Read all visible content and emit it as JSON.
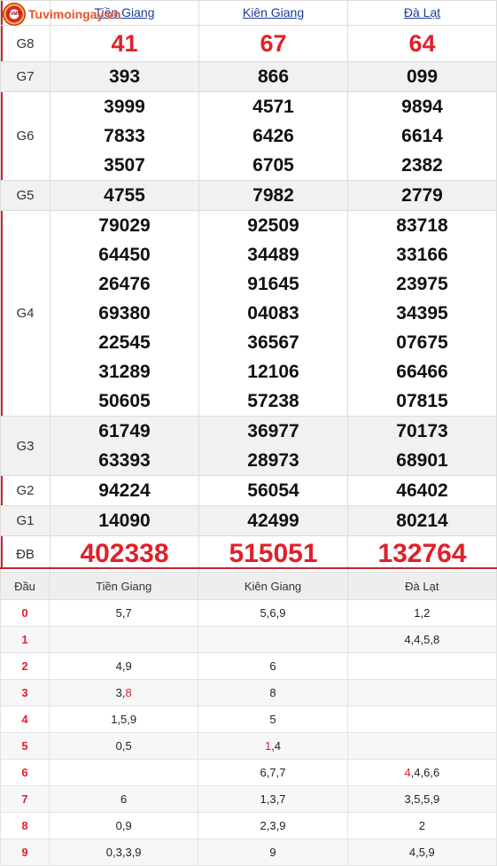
{
  "site": {
    "logo_text": "Tuvimoingay.vn",
    "logo_badge": "TVMN"
  },
  "provinces": [
    "Tiền Giang",
    "Kiên Giang",
    "Đà Lạt"
  ],
  "prizes": [
    {
      "label": "G8",
      "values": [
        [
          "41"
        ],
        [
          "67"
        ],
        [
          "64"
        ]
      ]
    },
    {
      "label": "G7",
      "values": [
        [
          "393"
        ],
        [
          "866"
        ],
        [
          "099"
        ]
      ]
    },
    {
      "label": "G6",
      "values": [
        [
          "3999",
          "7833",
          "3507"
        ],
        [
          "4571",
          "6426",
          "6705"
        ],
        [
          "9894",
          "6614",
          "2382"
        ]
      ]
    },
    {
      "label": "G5",
      "values": [
        [
          "4755"
        ],
        [
          "7982"
        ],
        [
          "2779"
        ]
      ]
    },
    {
      "label": "G4",
      "values": [
        [
          "79029",
          "64450",
          "26476",
          "69380",
          "22545",
          "31289",
          "50605"
        ],
        [
          "92509",
          "34489",
          "91645",
          "04083",
          "36567",
          "12106",
          "57238"
        ],
        [
          "83718",
          "33166",
          "23975",
          "34395",
          "07675",
          "66466",
          "07815"
        ]
      ]
    },
    {
      "label": "G3",
      "values": [
        [
          "61749",
          "63393"
        ],
        [
          "36977",
          "28973"
        ],
        [
          "70173",
          "68901"
        ]
      ]
    },
    {
      "label": "G2",
      "values": [
        [
          "94224"
        ],
        [
          "56054"
        ],
        [
          "46402"
        ]
      ]
    },
    {
      "label": "G1",
      "values": [
        [
          "14090"
        ],
        [
          "42499"
        ],
        [
          "80214"
        ]
      ]
    },
    {
      "label": "ĐB",
      "values": [
        [
          "402338"
        ],
        [
          "515051"
        ],
        [
          "132764"
        ]
      ]
    }
  ],
  "loto": {
    "header": [
      "Đầu",
      "Tiền Giang",
      "Kiên Giang",
      "Đà Lạt"
    ],
    "rows": [
      {
        "head": "0",
        "cells": [
          [
            [
              "5,7",
              false
            ]
          ],
          [
            [
              "5,6,9",
              false
            ]
          ],
          [
            [
              "1,2",
              false
            ]
          ]
        ]
      },
      {
        "head": "1",
        "cells": [
          [],
          [],
          [
            [
              "4,4,5,8",
              false
            ]
          ]
        ]
      },
      {
        "head": "2",
        "cells": [
          [
            [
              "4,9",
              false
            ]
          ],
          [
            [
              "6",
              false
            ]
          ],
          []
        ]
      },
      {
        "head": "3",
        "cells": [
          [
            [
              "3,",
              false
            ],
            [
              "8",
              true
            ]
          ],
          [
            [
              "8",
              false
            ]
          ],
          []
        ]
      },
      {
        "head": "4",
        "cells": [
          [
            [
              "1,5,9",
              false
            ]
          ],
          [
            [
              "5",
              false
            ]
          ],
          []
        ]
      },
      {
        "head": "5",
        "cells": [
          [
            [
              "0,5",
              false
            ]
          ],
          [
            [
              "1",
              true
            ],
            [
              ",4",
              false
            ]
          ],
          []
        ]
      },
      {
        "head": "6",
        "cells": [
          [],
          [
            [
              "6,7,7",
              false
            ]
          ],
          [
            [
              "4",
              true
            ],
            [
              ",4,6,6",
              false
            ]
          ]
        ]
      },
      {
        "head": "7",
        "cells": [
          [
            [
              "6",
              false
            ]
          ],
          [
            [
              "1,3,7",
              false
            ]
          ],
          [
            [
              "3,5,5,9",
              false
            ]
          ]
        ]
      },
      {
        "head": "8",
        "cells": [
          [
            [
              "0,9",
              false
            ]
          ],
          [
            [
              "2,3,9",
              false
            ]
          ],
          [
            [
              "2",
              false
            ]
          ]
        ]
      },
      {
        "head": "9",
        "cells": [
          [
            [
              "0,3,3,9",
              false
            ]
          ],
          [
            [
              "9",
              false
            ]
          ],
          [
            [
              "4,5,9",
              false
            ]
          ]
        ]
      }
    ]
  }
}
